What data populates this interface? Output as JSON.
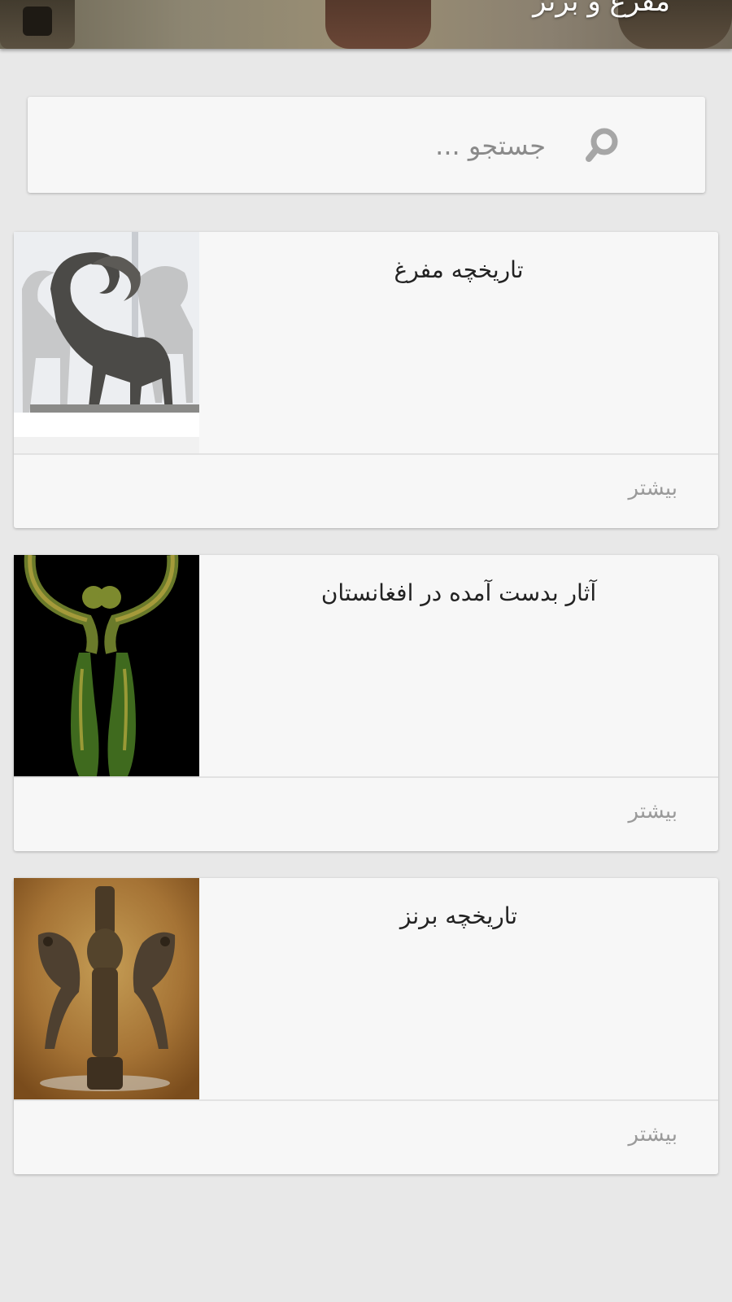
{
  "header": {
    "title": "مفرغ و برنز"
  },
  "search": {
    "placeholder": "جستجو ...",
    "icon": "search-icon"
  },
  "cards": [
    {
      "title": "تاریخچه مفرغ",
      "more_label": "بیشتر",
      "image": "bronze-rams-sculpture"
    },
    {
      "title": "آثار بدست آمده در افغانستان",
      "more_label": "بیشتر",
      "image": "green-bronze-figures"
    },
    {
      "title": "تاریخچه برنز",
      "more_label": "بیشتر",
      "image": "luristan-bronze-finial"
    }
  ],
  "colors": {
    "background": "#e8e8e8",
    "card": "#f7f7f7",
    "title_text": "#222222",
    "more_text": "#9a9a9a",
    "placeholder_text": "#8a8a8a",
    "icon": "#a6a6a6"
  }
}
